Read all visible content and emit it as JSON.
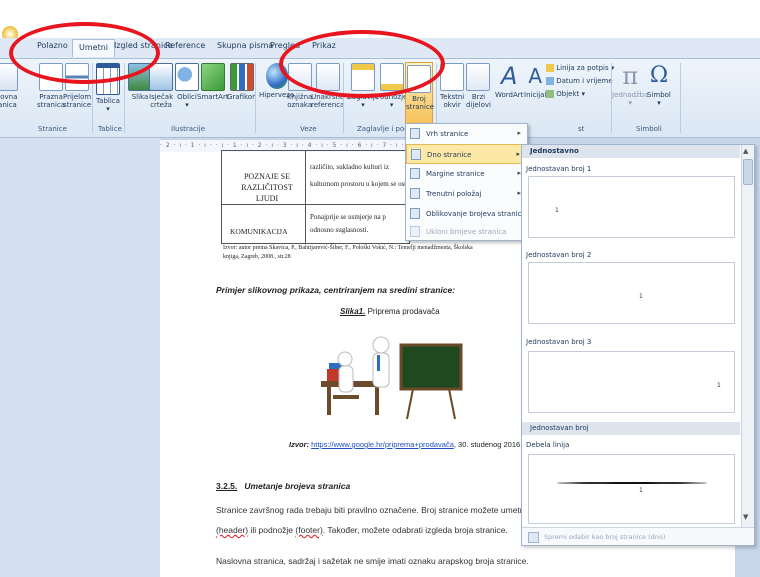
{
  "ribbon_tabs": {
    "home": "Polazno",
    "insert": "Umetni",
    "page_layout": "Izgled stranice",
    "references": "Reference",
    "mailings": "Skupna pisma",
    "review": "Pregled",
    "view": "Prikaz"
  },
  "ribbon": {
    "cover_page": "Naslovna stranica",
    "cover_page_short": "slovna",
    "cover_page_l2": "ranica",
    "blank_page": "Prazna",
    "blank_page_l2": "stranica",
    "page_break": "Prijelom",
    "page_break_l2": "stranice",
    "group_pages": "Stranice",
    "table": "Tablica",
    "group_tables": "Tablice",
    "picture": "Slika",
    "clipart": "Isječak",
    "clipart_l2": "crteža",
    "shapes": "Oblici",
    "smartart": "SmartArt",
    "chart": "Grafikon",
    "group_illustrations": "Ilustracije",
    "hyperlink": "Hiperveza",
    "bookmark": "Knjižna",
    "bookmark_l2": "oznaka",
    "cross_ref": "Unakrsna",
    "cross_ref_l2": "referenca",
    "group_links": "Veze",
    "header": "Zaglavlje",
    "footer": "Podnožje",
    "page_number": "Broj",
    "page_number_l2": "stranice",
    "group_header_footer": "Zaglavlje i pod",
    "textbox": "Tekstni",
    "textbox_l2": "okvir",
    "quickparts": "Brzi",
    "quickparts_l2": "dijelovi",
    "wordart": "WordArt",
    "dropcap": "Inicijal",
    "signature_line": "Linija za potpis",
    "datetime": "Datum i vrijeme",
    "object": "Objekt",
    "group_text_suffix": "st",
    "equation": "Jednadžba",
    "symbol": "Simbol",
    "group_symbols": "Simboli"
  },
  "menu": {
    "top": "Vrh stranice",
    "bottom": "Dno stranice",
    "margins": "Margine stranice",
    "current": "Trenutni položaj",
    "format": "Oblikovanje brojeva stranica...",
    "remove": "Ukloni brojeve stranica"
  },
  "gallery": {
    "header1": "Jednostavno",
    "item1": "Jednostavan broj 1",
    "item2": "Jednostavan broj 2",
    "item3": "Jednostavan broj 3",
    "header2": "Jednostavan broj",
    "item4": "Debela linija",
    "footer_action": "Spremi odabir kao broj stranice (dno)",
    "preview_num": "1"
  },
  "document": {
    "table_row1_left_l1": "POZNAJE SE",
    "table_row1_left_l2": "RAZLIČITOST LJUDI",
    "table_row1_right_l1": "različito, sukladno kulturi iz",
    "table_row1_right_l2": "kulturnom prostoru u kojem se ost",
    "table_row2_left": "KOMUNIKACIJA",
    "table_row2_right_l1": "Ponajprije se usmjerje na p",
    "table_row2_right_l2": "odnosno suglasnosti.",
    "source_l1": "Izvor: autor prema Skavica, P., Bahtijarević-Šiber, F., Pološki Vokić, N.: Temelji menadžmenta, Školska",
    "source_l2": "knjiga, Zagreb, 2008., str.28",
    "example_heading": "Primjer slikovnog prikaza, centriranjem na sredini stranice:",
    "figure_label": "Slika1.",
    "figure_title": " Priprema prodavača",
    "figure_source_prefix": "Izvor: ",
    "figure_source_link": "https://www.google.hr/priprema+prodavača",
    "figure_source_suffix": ", 30. studenog 2016.",
    "section_number": "3.2.5.",
    "section_title": "Umetanje brojeva stranica",
    "para1_l1": "Stranice završnog rada trebaju biti pravilno označene. Broj stranice možete umetnuti ili u",
    "para1_l2_a": "(header)",
    "para1_l2_b": " ili podnožje ",
    "para1_l2_c": "(footer)",
    "para1_l2_d": ". Također, možete odabrati izgleda broja stranice.",
    "para2": "Naslovna stranica, sadržaj i sažetak ne smije imati oznaku arapskog broja stranice."
  },
  "ruler_text": "· 2 · ı · 1 · ı ·   · ı · 1 · ı · 2 · ı · 3 · ı · 4 · ı · 5 · ı · 6 · ı · 7 · ı · 8 · ı ·",
  "colors": {
    "annotation_red": "#e8141e",
    "menu_highlight": "#fde9a6",
    "ribbon_text": "#1e395b",
    "link_blue": "#1f4fbf"
  }
}
